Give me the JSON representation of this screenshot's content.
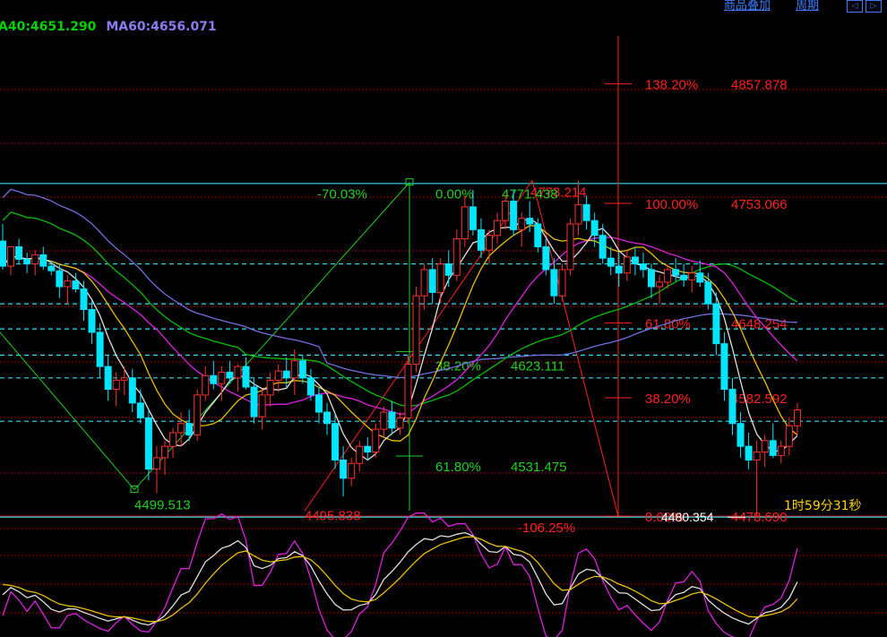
{
  "toolbar": {
    "links": [
      "商品叠加",
      "周期"
    ],
    "nav_buttons": [
      "◁",
      "▷"
    ]
  },
  "legend": {
    "ma40": "A40:4651.290",
    "ma60": "MA60:4656.071",
    "ma40_color": "#00d000",
    "ma60_color": "#8a7cf0"
  },
  "timer": "1时59分31秒",
  "colors": {
    "up": "#ff3030",
    "down": "#00e5ff",
    "grid": "#a00000",
    "fib_green": "#20d020",
    "fib_red": "#ff2020",
    "ma5": "#e0e0e0",
    "ma10": "#e8c000",
    "ma20": "#e020e0",
    "ma40": "#00c000",
    "ma60": "#7070e0"
  },
  "chart_data": {
    "type": "candlestick",
    "y_range": [
      4460,
      4900
    ],
    "fib_green_left": {
      "low_label": "4499.513",
      "labels": [
        {
          "value": 4771.438,
          "pct": "-70.03%"
        },
        {
          "value": 4771.438,
          "pct": "0.00%",
          "price": "4771.438"
        },
        {
          "value": 4623.111,
          "pct": "38.20%",
          "price": "4623.111"
        },
        {
          "value": 4531.475,
          "pct": "61.80%",
          "price": "4531.475"
        }
      ]
    },
    "fib_red_right": {
      "low_label": "4495.838",
      "peak_label": "4773.214",
      "pct_neg": "-106.25%",
      "levels": [
        {
          "value": 4857.878,
          "pct": "138.20%",
          "price": "4857.878"
        },
        {
          "value": 4753.066,
          "pct": "100.00%",
          "price": "4753.066"
        },
        {
          "value": 4648.254,
          "pct": "61.80%",
          "price": "4648.254"
        },
        {
          "value": 4582.592,
          "pct": "38.20%",
          "price": "4582.592"
        },
        {
          "value": 4478.69,
          "pct": "0.00%",
          "price": "4478.690"
        }
      ]
    },
    "current_price_label": "4480.354",
    "cyan_levels": [
      4770.5,
      4700,
      4665,
      4643,
      4620,
      4600,
      4562,
      4478
    ],
    "red_grid_levels": [
      4815,
      4859,
      4685,
      4582
    ],
    "candles": [
      [
        4720,
        4735,
        4695,
        4698
      ],
      [
        4698,
        4710,
        4690,
        4715
      ],
      [
        4715,
        4722,
        4700,
        4704
      ],
      [
        4704,
        4710,
        4692,
        4700
      ],
      [
        4700,
        4712,
        4690,
        4708
      ],
      [
        4708,
        4715,
        4695,
        4698
      ],
      [
        4698,
        4703,
        4690,
        4694
      ],
      [
        4694,
        4700,
        4670,
        4680
      ],
      [
        4680,
        4690,
        4665,
        4685
      ],
      [
        4685,
        4692,
        4675,
        4678
      ],
      [
        4678,
        4685,
        4650,
        4660
      ],
      [
        4660,
        4668,
        4630,
        4640
      ],
      [
        4640,
        4648,
        4600,
        4610
      ],
      [
        4610,
        4620,
        4580,
        4590
      ],
      [
        4590,
        4605,
        4575,
        4598
      ],
      [
        4598,
        4610,
        4585,
        4600
      ],
      [
        4600,
        4608,
        4570,
        4578
      ],
      [
        4578,
        4590,
        4560,
        4565
      ],
      [
        4565,
        4572,
        4510,
        4520
      ],
      [
        4520,
        4540,
        4499,
        4530
      ],
      [
        4530,
        4545,
        4515,
        4540
      ],
      [
        4540,
        4556,
        4530,
        4552
      ],
      [
        4552,
        4570,
        4540,
        4560
      ],
      [
        4560,
        4572,
        4545,
        4550
      ],
      [
        4550,
        4590,
        4545,
        4585
      ],
      [
        4585,
        4610,
        4580,
        4602
      ],
      [
        4602,
        4615,
        4590,
        4595
      ],
      [
        4595,
        4610,
        4580,
        4605
      ],
      [
        4605,
        4615,
        4595,
        4600
      ],
      [
        4600,
        4612,
        4588,
        4610
      ],
      [
        4610,
        4618,
        4590,
        4592
      ],
      [
        4592,
        4600,
        4560,
        4566
      ],
      [
        4566,
        4590,
        4555,
        4585
      ],
      [
        4585,
        4605,
        4575,
        4598
      ],
      [
        4598,
        4612,
        4588,
        4606
      ],
      [
        4606,
        4618,
        4592,
        4600
      ],
      [
        4600,
        4625,
        4585,
        4615
      ],
      [
        4615,
        4620,
        4595,
        4600
      ],
      [
        4600,
        4608,
        4580,
        4585
      ],
      [
        4585,
        4592,
        4560,
        4570
      ],
      [
        4570,
        4578,
        4550,
        4560
      ],
      [
        4560,
        4568,
        4520,
        4528
      ],
      [
        4528,
        4540,
        4496,
        4512
      ],
      [
        4512,
        4530,
        4505,
        4525
      ],
      [
        4525,
        4545,
        4518,
        4540
      ],
      [
        4540,
        4548,
        4528,
        4535
      ],
      [
        4535,
        4560,
        4530,
        4555
      ],
      [
        4555,
        4575,
        4548,
        4570
      ],
      [
        4570,
        4580,
        4550,
        4556
      ],
      [
        4556,
        4570,
        4550,
        4565
      ],
      [
        4565,
        4620,
        4560,
        4612
      ],
      [
        4612,
        4680,
        4605,
        4672
      ],
      [
        4672,
        4700,
        4660,
        4695
      ],
      [
        4695,
        4705,
        4665,
        4675
      ],
      [
        4675,
        4705,
        4665,
        4700
      ],
      [
        4700,
        4712,
        4680,
        4690
      ],
      [
        4690,
        4730,
        4685,
        4722
      ],
      [
        4722,
        4760,
        4715,
        4750
      ],
      [
        4750,
        4765,
        4725,
        4730
      ],
      [
        4730,
        4740,
        4705,
        4712
      ],
      [
        4712,
        4730,
        4700,
        4725
      ],
      [
        4725,
        4745,
        4718,
        4738
      ],
      [
        4738,
        4760,
        4730,
        4755
      ],
      [
        4755,
        4765,
        4725,
        4730
      ],
      [
        4730,
        4745,
        4715,
        4740
      ],
      [
        4740,
        4755,
        4728,
        4735
      ],
      [
        4735,
        4740,
        4710,
        4715
      ],
      [
        4715,
        4722,
        4690,
        4695
      ],
      [
        4695,
        4705,
        4665,
        4672
      ],
      [
        4672,
        4700,
        4668,
        4695
      ],
      [
        4695,
        4740,
        4690,
        4735
      ],
      [
        4735,
        4773,
        4725,
        4752
      ],
      [
        4752,
        4760,
        4730,
        4738
      ],
      [
        4738,
        4745,
        4715,
        4725
      ],
      [
        4725,
        4735,
        4700,
        4705
      ],
      [
        4705,
        4715,
        4690,
        4698
      ],
      [
        4698,
        4710,
        4680,
        4692
      ],
      [
        4692,
        4712,
        4685,
        4706
      ],
      [
        4706,
        4715,
        4690,
        4700
      ],
      [
        4700,
        4710,
        4688,
        4695
      ],
      [
        4695,
        4700,
        4670,
        4680
      ],
      [
        4680,
        4690,
        4665,
        4684
      ],
      [
        4684,
        4700,
        4678,
        4695
      ],
      [
        4695,
        4705,
        4685,
        4690
      ],
      [
        4690,
        4700,
        4680,
        4686
      ],
      [
        4686,
        4698,
        4675,
        4692
      ],
      [
        4692,
        4703,
        4680,
        4684
      ],
      [
        4684,
        4692,
        4660,
        4665
      ],
      [
        4665,
        4675,
        4620,
        4630
      ],
      [
        4630,
        4640,
        4580,
        4590
      ],
      [
        4590,
        4600,
        4550,
        4560
      ],
      [
        4560,
        4570,
        4530,
        4540
      ],
      [
        4540,
        4552,
        4520,
        4528
      ],
      [
        4528,
        4545,
        4479,
        4535
      ],
      [
        4535,
        4550,
        4522,
        4545
      ],
      [
        4545,
        4560,
        4530,
        4532
      ],
      [
        4532,
        4545,
        4525,
        4540
      ],
      [
        4540,
        4565,
        4532,
        4558
      ],
      [
        4558,
        4578,
        4550,
        4572
      ]
    ]
  }
}
